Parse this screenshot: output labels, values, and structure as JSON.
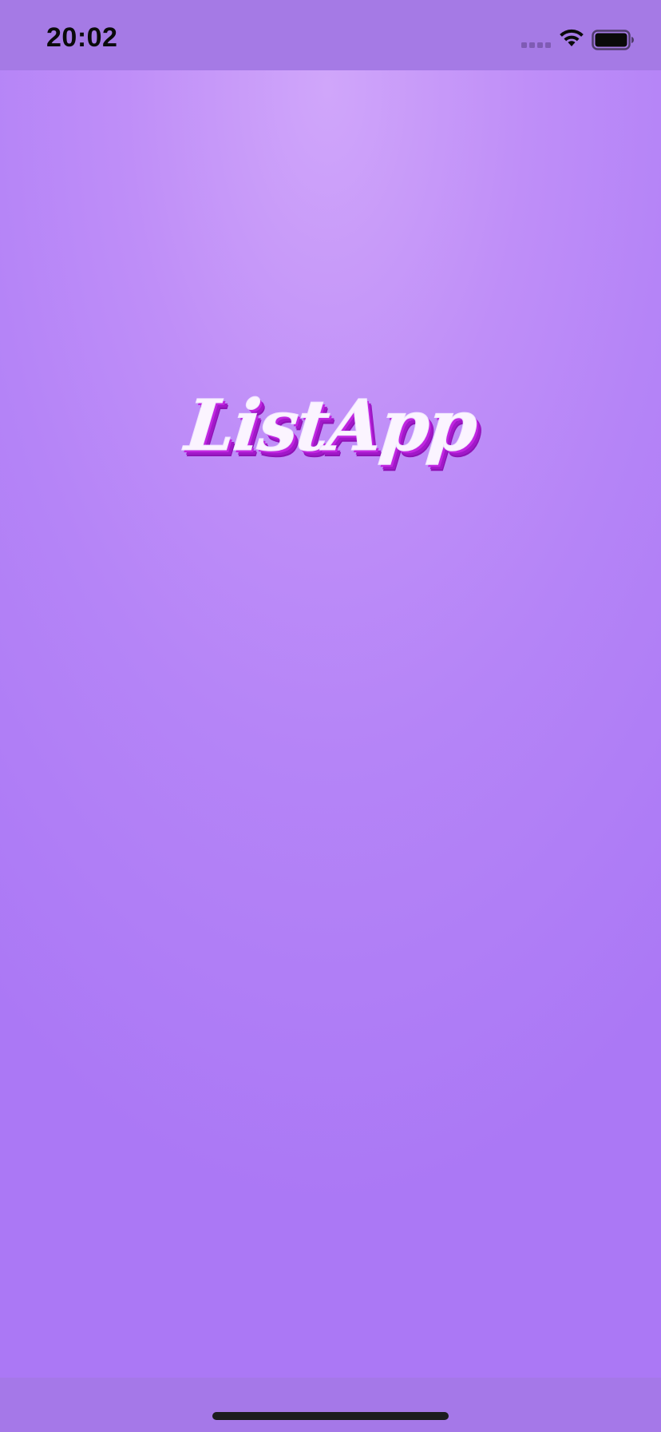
{
  "status_bar": {
    "time": "20:02",
    "icons": [
      "cellular-signal-icon",
      "wifi-icon",
      "battery-icon"
    ]
  },
  "splash": {
    "app_name": "ListApp"
  },
  "colors": {
    "background_top": "#d0a6fa",
    "background_bottom": "#ab78f5",
    "status_bar": "#a57ae5",
    "logo_text": "#fbf4ff",
    "logo_shadow": "#c026e0"
  }
}
